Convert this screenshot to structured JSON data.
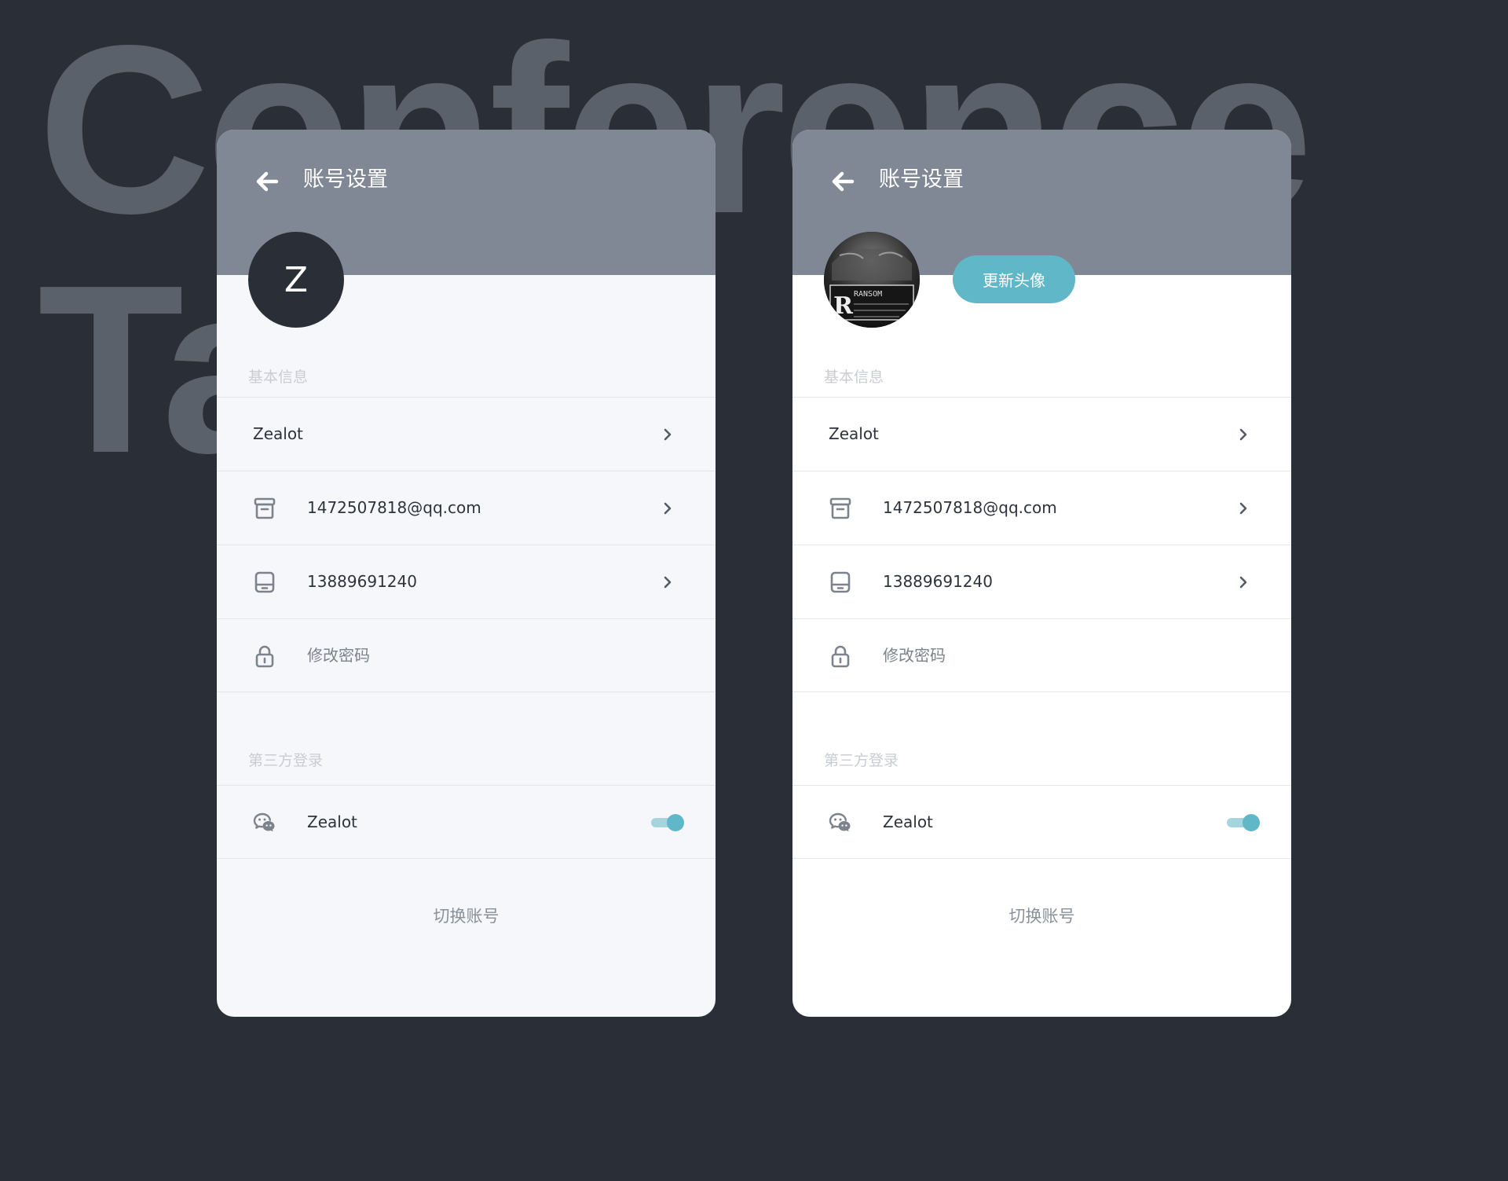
{
  "background": {
    "title_line1": "Conference",
    "title_line2": "Ta"
  },
  "colors": {
    "page_bg": "#2a2f37",
    "header_bg": "#7f8894",
    "accent": "#5fb7c8",
    "avatar_bg": "#2a2f37"
  },
  "cards": [
    {
      "header_title": "账号设置",
      "avatar_initial": "Z",
      "section_basic": "基本信息",
      "name_row": "Zealot",
      "email_row": "1472507818@qq.com",
      "phone_row": "13889691240",
      "password_row": "修改密码",
      "section_third_party": "第三方登录",
      "wechat_row": "Zealot",
      "wechat_toggle_on": true,
      "switch_account": "切换账号"
    },
    {
      "header_title": "账号设置",
      "update_avatar_button": "更新头像",
      "avatar_photo_text": "RANSOM",
      "section_basic": "基本信息",
      "name_row": "Zealot",
      "email_row": "1472507818@qq.com",
      "phone_row": "13889691240",
      "password_row": "修改密码",
      "section_third_party": "第三方登录",
      "wechat_row": "Zealot",
      "wechat_toggle_on": true,
      "switch_account": "切换账号"
    }
  ],
  "icons": {
    "back": "arrow-left-icon",
    "email": "archive-box-icon",
    "phone": "phone-device-icon",
    "password": "lock-icon",
    "wechat": "wechat-icon",
    "chevron": "chevron-right-icon"
  }
}
